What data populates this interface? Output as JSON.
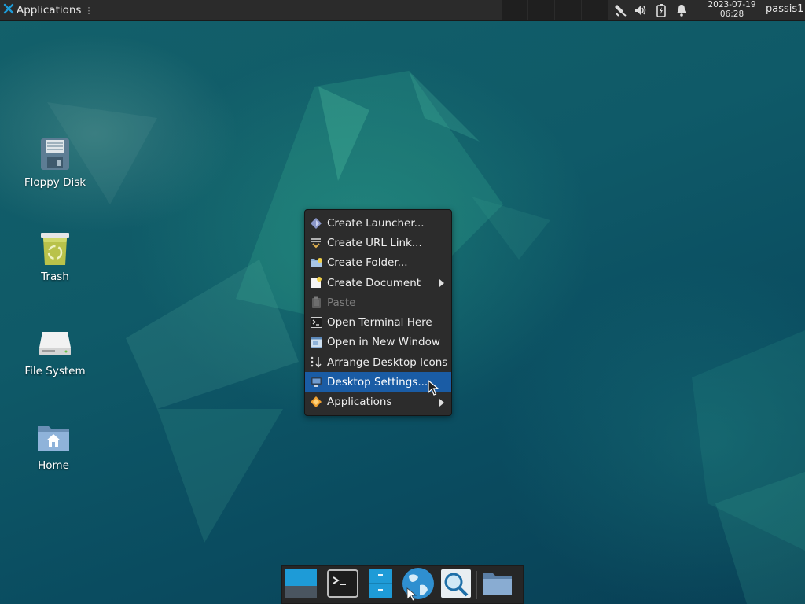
{
  "top_panel": {
    "applications_label": "Applications",
    "handle": "⋮",
    "clock_date": "2023-07-19",
    "clock_time": "06:28",
    "user": "passis1",
    "tray_icons": [
      "network-icon",
      "volume-icon",
      "battery-icon",
      "notification-bell-icon"
    ]
  },
  "desktop_icons": [
    {
      "label": "Floppy Disk",
      "icon": "floppy-disk-icon"
    },
    {
      "label": "Trash",
      "icon": "trash-icon"
    },
    {
      "label": "File System",
      "icon": "drive-icon"
    },
    {
      "label": "Home",
      "icon": "home-folder-icon"
    }
  ],
  "context_menu": {
    "items": [
      {
        "label": "Create Launcher...",
        "icon": "launcher-icon",
        "submenu": false,
        "enabled": true,
        "selected": false
      },
      {
        "label": "Create URL Link...",
        "icon": "url-link-icon",
        "submenu": false,
        "enabled": true,
        "selected": false
      },
      {
        "label": "Create Folder...",
        "icon": "new-folder-icon",
        "submenu": false,
        "enabled": true,
        "selected": false
      },
      {
        "label": "Create Document",
        "icon": "new-document-icon",
        "submenu": true,
        "enabled": true,
        "selected": false
      },
      {
        "label": "Paste",
        "icon": "paste-icon",
        "submenu": false,
        "enabled": false,
        "selected": false
      },
      {
        "label": "Open Terminal Here",
        "icon": "terminal-icon",
        "submenu": false,
        "enabled": true,
        "selected": false
      },
      {
        "label": "Open in New Window",
        "icon": "new-window-icon",
        "submenu": false,
        "enabled": true,
        "selected": false
      },
      {
        "label": "Arrange Desktop Icons",
        "icon": "arrange-icon",
        "submenu": false,
        "enabled": true,
        "selected": false
      },
      {
        "label": "Desktop Settings...",
        "icon": "desktop-settings-icon",
        "submenu": false,
        "enabled": true,
        "selected": true
      },
      {
        "label": "Applications",
        "icon": "applications-icon",
        "submenu": true,
        "enabled": true,
        "selected": false
      }
    ]
  },
  "dock": {
    "items": [
      "show-desktop-icon",
      "terminal-icon",
      "file-manager-icon",
      "web-browser-icon",
      "app-finder-icon",
      "folder-icon"
    ]
  },
  "colors": {
    "panel": "#2b2b2b",
    "menu_bg": "#2c2c2c",
    "menu_selected": "#1a5ca5",
    "accent": "#1e9bd7"
  }
}
